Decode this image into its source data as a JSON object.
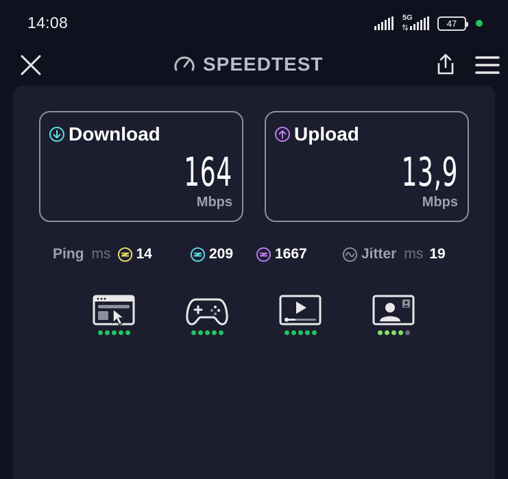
{
  "status_bar": {
    "time": "14:08",
    "network_label": "5G",
    "battery": "47",
    "icons": [
      "signal-icon",
      "signal-5g-icon",
      "battery-icon",
      "notification-dot-icon"
    ]
  },
  "header": {
    "title": "SPEEDTEST",
    "icons": [
      "close-icon",
      "speedometer-icon",
      "share-icon",
      "menu-icon"
    ]
  },
  "results": {
    "download": {
      "label": "Download",
      "value": "164",
      "unit": "Mbps",
      "icon": "download-arrow-icon",
      "accent": "#5fe0e8"
    },
    "upload": {
      "label": "Upload",
      "value": "13,9",
      "unit": "Mbps",
      "icon": "upload-arrow-icon",
      "accent": "#c27cf5"
    }
  },
  "metrics": {
    "ping_label": "Ping",
    "ping_unit": "ms",
    "ping_idle": "14",
    "ping_download": "209",
    "ping_upload": "1667",
    "jitter_label": "Jitter",
    "jitter_unit": "ms",
    "jitter": "19",
    "colors": {
      "idle": "#f4e36b",
      "download": "#5fe0e8",
      "upload": "#c27cf5",
      "jitter": "#8d8f9d"
    }
  },
  "experience": [
    {
      "icon": "web-browsing-icon",
      "rating": 5,
      "max": 5,
      "color": "#22c55e"
    },
    {
      "icon": "gaming-icon",
      "rating": 5,
      "max": 5,
      "color": "#22c55e"
    },
    {
      "icon": "video-streaming-icon",
      "rating": 5,
      "max": 5,
      "color": "#22c55e"
    },
    {
      "icon": "video-call-icon",
      "rating": 4,
      "max": 5,
      "color": "#84e06b"
    }
  ]
}
